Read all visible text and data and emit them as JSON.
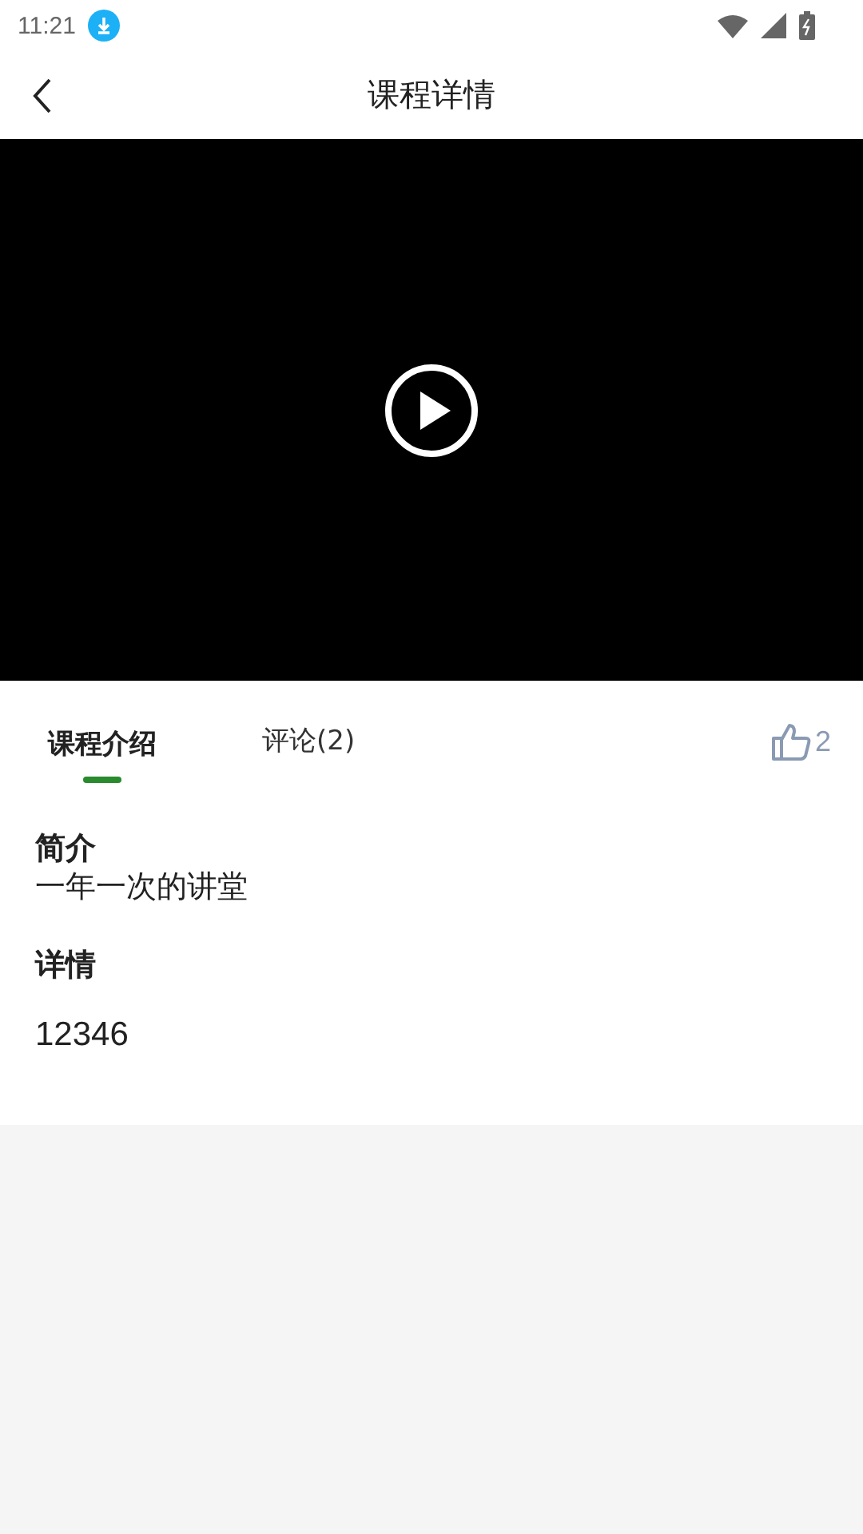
{
  "status_bar": {
    "time": "11:21"
  },
  "header": {
    "title": "课程详情"
  },
  "tabs": [
    {
      "label": "课程介绍",
      "selected": true
    },
    {
      "label": "评论(2)",
      "selected": false
    }
  ],
  "likes": {
    "count": "2"
  },
  "intro": {
    "heading": "简介",
    "text": "一年一次的讲堂"
  },
  "details": {
    "heading": "详情",
    "text": "12346"
  }
}
